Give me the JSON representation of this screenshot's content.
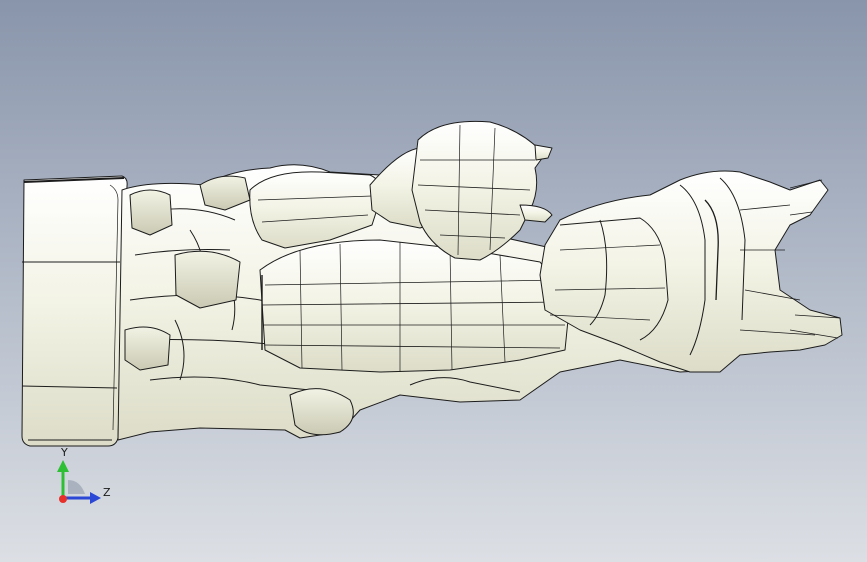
{
  "viewport": {
    "background_top": "#8a97ad",
    "background_bottom": "#d9dce2",
    "model_fill": "#f1f1e3",
    "edge_color": "#1c1c1c"
  },
  "triad": {
    "y_label": "Y",
    "z_label": "Z",
    "x_color": "#e8302b",
    "y_color": "#2fbf35",
    "z_color": "#2a47d6"
  }
}
